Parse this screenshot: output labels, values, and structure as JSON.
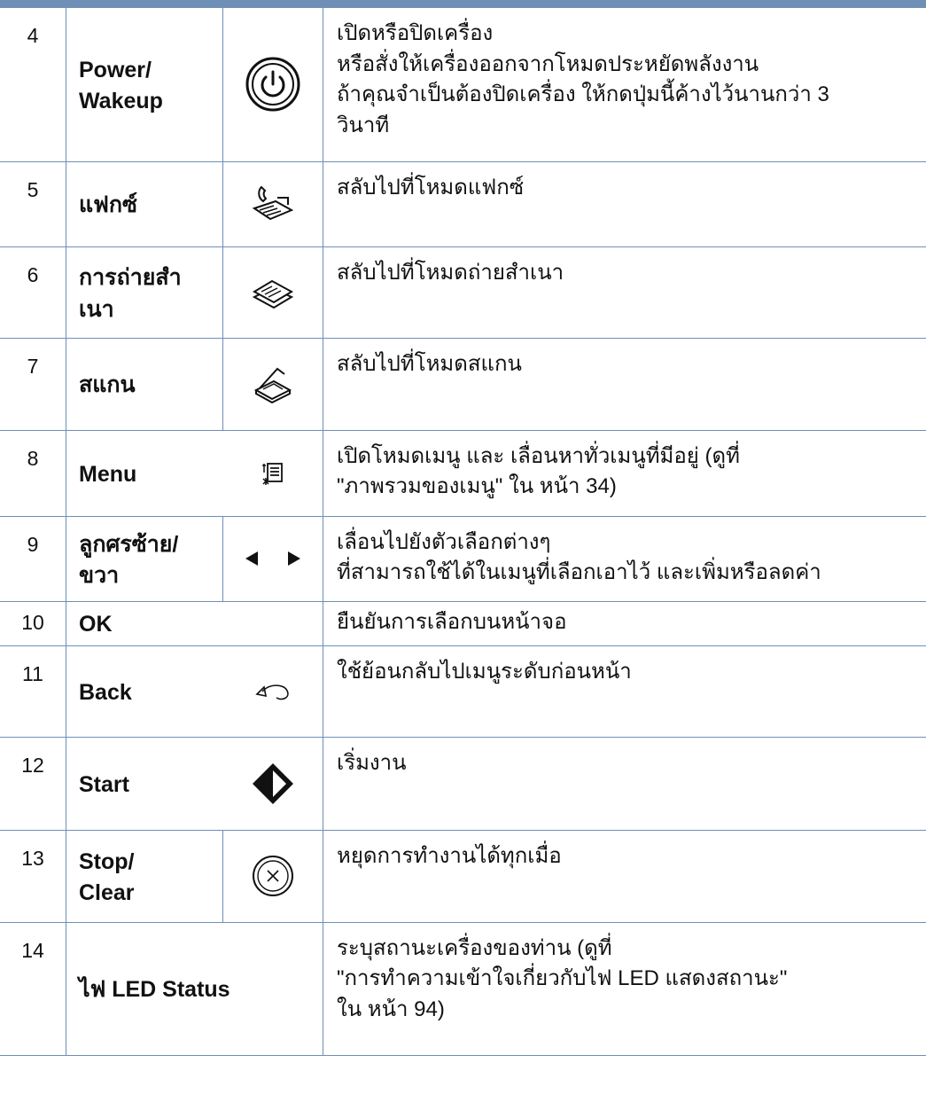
{
  "rows": [
    {
      "num": "4",
      "name_line1": "Power/",
      "name_line2": "Wakeup",
      "icon": "power-icon",
      "desc": [
        "เปิดหรือปิดเครื่อง",
        "หรือสั่งให้เครื่องออกจากโหมดประหยัดพลังงาน",
        "ถ้าคุณจำเป็นต้องปิดเครื่อง ให้กดปุ่มนี้ค้างไว้นานกว่า 3",
        "วินาที"
      ]
    },
    {
      "num": "5",
      "name_line1": "แฟกซ์",
      "icon": "fax-icon",
      "desc": [
        "สลับไปที่โหมดแฟกซ์"
      ]
    },
    {
      "num": "6",
      "name_line1": "การถ่ายสำ",
      "name_line2": "เนา",
      "icon": "copy-icon",
      "desc": [
        "สลับไปที่โหมดถ่ายสำเนา"
      ]
    },
    {
      "num": "7",
      "name_line1": "สแกน",
      "icon": "scan-icon",
      "desc": [
        "สลับไปที่โหมดสแกน"
      ]
    },
    {
      "num": "8",
      "name_line1": "Menu",
      "icon": "menu-icon",
      "desc": [
        "เปิดโหมดเมนู และ เลื่อนหาทั่วเมนูที่มีอยู่ (ดูที่",
        "\"ภาพรวมของเมนู\"  ใน หน้า 34)"
      ]
    },
    {
      "num": "9",
      "name_line1": "ลูกศรซ้าย/",
      "name_line2": "ขวา",
      "icon": "left-right-arrows-icon",
      "desc": [
        "เลื่อนไปยังตัวเลือกต่างๆ",
        "ที่สามารถใช้ได้ในเมนูที่เลือกเอาไว้ และเพิ่มหรือลดค่า"
      ]
    },
    {
      "num": "10",
      "name_line1": "OK",
      "desc": [
        "ยืนยันการเลือกบนหน้าจอ"
      ]
    },
    {
      "num": "11",
      "name_line1": "Back",
      "icon": "back-icon",
      "desc": [
        "ใช้ย้อนกลับไปเมนูระดับก่อนหน้า"
      ]
    },
    {
      "num": "12",
      "name_line1": "Start",
      "icon": "start-icon",
      "desc": [
        "เริ่มงาน"
      ]
    },
    {
      "num": "13",
      "name_line1": "Stop/",
      "name_line2": "Clear",
      "icon": "stop-clear-icon",
      "desc": [
        "หยุดการทำงานได้ทุกเมื่อ"
      ]
    },
    {
      "num": "14",
      "name_line1": "ไฟ LED Status",
      "desc": [
        "ระบุสถานะเครื่องของท่าน (ดูที่",
        "\"การทำความเข้าใจเกี่ยวกับไฟ LED แสดงสถานะ\"",
        "ใน หน้า 94)"
      ]
    }
  ],
  "colors": {
    "rule": "#6e8fb6",
    "text": "#111111"
  }
}
